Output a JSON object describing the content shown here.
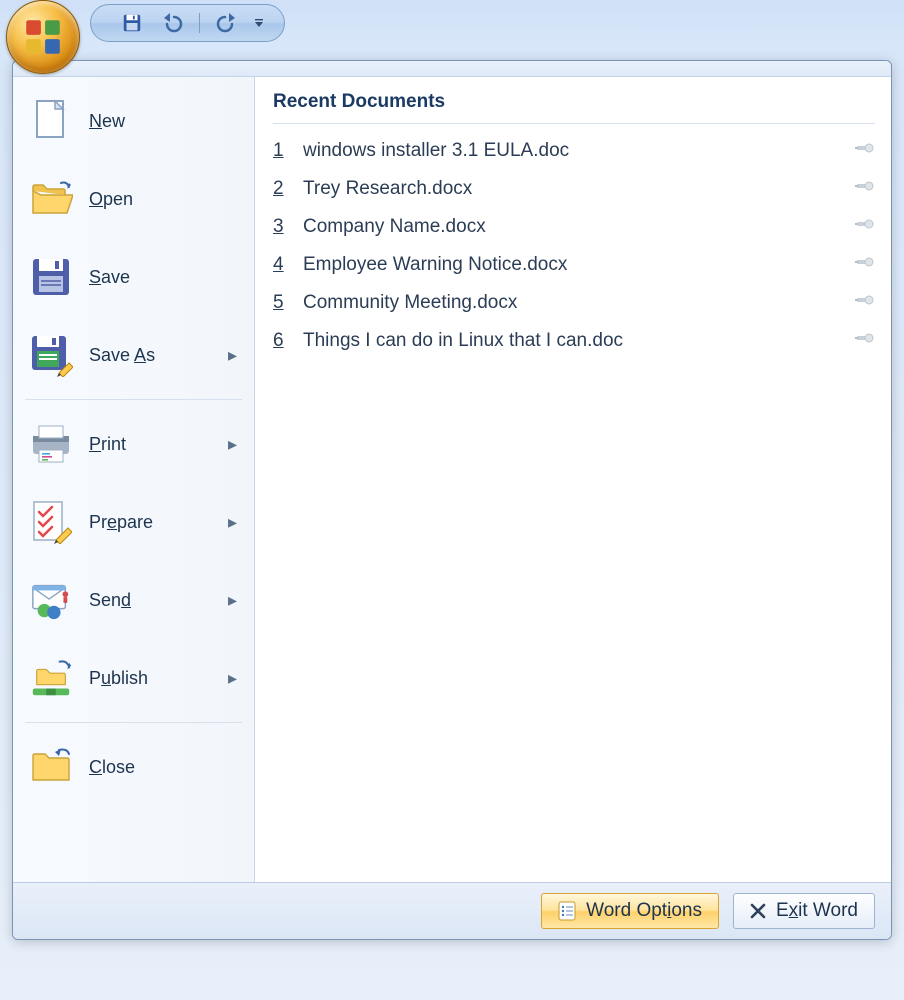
{
  "menu": {
    "items": [
      {
        "id": "new",
        "label_pre": "",
        "label_u": "N",
        "label_post": "ew",
        "submenu": false
      },
      {
        "id": "open",
        "label_pre": "",
        "label_u": "O",
        "label_post": "pen",
        "submenu": false
      },
      {
        "id": "save",
        "label_pre": "",
        "label_u": "S",
        "label_post": "ave",
        "submenu": false
      },
      {
        "id": "saveas",
        "label_pre": "Save ",
        "label_u": "A",
        "label_post": "s",
        "submenu": true
      },
      {
        "id": "print",
        "label_pre": "",
        "label_u": "P",
        "label_post": "rint",
        "submenu": true
      },
      {
        "id": "prepare",
        "label_pre": "Pr",
        "label_u": "e",
        "label_post": "pare",
        "submenu": true
      },
      {
        "id": "send",
        "label_pre": "Sen",
        "label_u": "d",
        "label_post": "",
        "submenu": true
      },
      {
        "id": "publish",
        "label_pre": "P",
        "label_u": "u",
        "label_post": "blish",
        "submenu": true
      },
      {
        "id": "close",
        "label_pre": "",
        "label_u": "C",
        "label_post": "lose",
        "submenu": false
      }
    ]
  },
  "recent": {
    "header": "Recent Documents",
    "items": [
      {
        "n": "1",
        "name": "windows installer 3.1 EULA.doc"
      },
      {
        "n": "2",
        "name": "Trey Research.docx"
      },
      {
        "n": "3",
        "name": "Company Name.docx"
      },
      {
        "n": "4",
        "name": "Employee Warning Notice.docx"
      },
      {
        "n": "5",
        "name": "Community Meeting.docx"
      },
      {
        "n": "6",
        "name": "Things I can do in Linux that I can.doc"
      }
    ]
  },
  "footer": {
    "options_pre": "Word Opt",
    "options_u": "i",
    "options_post": "ons",
    "exit_pre": "E",
    "exit_u": "x",
    "exit_post": "it Word"
  },
  "dividers_after": [
    "saveas",
    "publish"
  ]
}
